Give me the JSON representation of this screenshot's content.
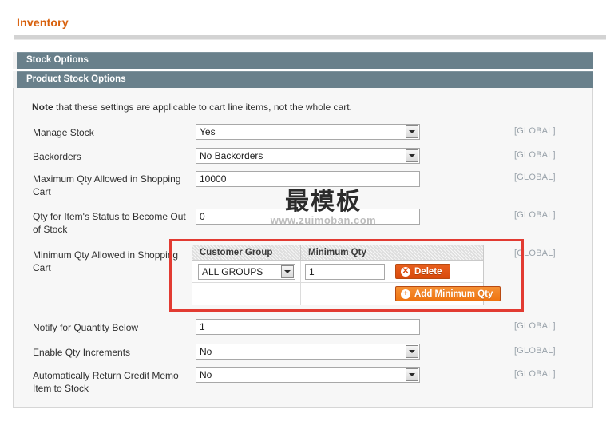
{
  "page": {
    "title": "Inventory"
  },
  "sections": {
    "stock_options": "Stock Options",
    "product_stock_options": "Product Stock Options"
  },
  "note": {
    "strong": "Note",
    "text": " that these settings are applicable to cart line items, not the whole cart."
  },
  "scope_label": "[GLOBAL]",
  "fields": [
    {
      "label": "Manage Stock",
      "type": "select",
      "value": "Yes",
      "scope": "[GLOBAL]"
    },
    {
      "label": "Backorders",
      "type": "select",
      "value": "No Backorders",
      "scope": "[GLOBAL]"
    },
    {
      "label": "Maximum Qty Allowed in Shopping Cart",
      "type": "text",
      "value": "10000",
      "scope": "[GLOBAL]"
    },
    {
      "label": "Qty for Item's Status to Become Out of Stock",
      "type": "text",
      "value": "0",
      "scope": "[GLOBAL]"
    },
    {
      "label": "Minimum Qty Allowed in Shopping Cart",
      "type": "grid",
      "scope": "[GLOBAL]"
    },
    {
      "label": "Notify for Quantity Below",
      "type": "text",
      "value": "1",
      "scope": "[GLOBAL]"
    },
    {
      "label": "Enable Qty Increments",
      "type": "select",
      "value": "No",
      "scope": "[GLOBAL]"
    },
    {
      "label": "Automatically Return Credit Memo Item to Stock",
      "type": "select",
      "value": "No",
      "scope": "[GLOBAL]"
    }
  ],
  "min_qty_grid": {
    "columns": [
      "Customer Group",
      "Minimum Qty",
      ""
    ],
    "rows": [
      {
        "customer_group": "ALL GROUPS",
        "minimum_qty": "1",
        "action_label": "Delete",
        "action_icon": "close-circle-icon"
      }
    ],
    "add_button": {
      "label": "Add Minimum Qty",
      "icon": "plus-circle-icon"
    }
  },
  "watermark": {
    "cn": "最模板",
    "url": "www.zuimoban.com"
  },
  "colors": {
    "accent": "#d8600c",
    "section_bar": "#69808b",
    "highlight": "#e23b32",
    "button_delete": "#d94a0c",
    "button_add": "#ef7411",
    "scope_text": "#9aa3ab"
  }
}
